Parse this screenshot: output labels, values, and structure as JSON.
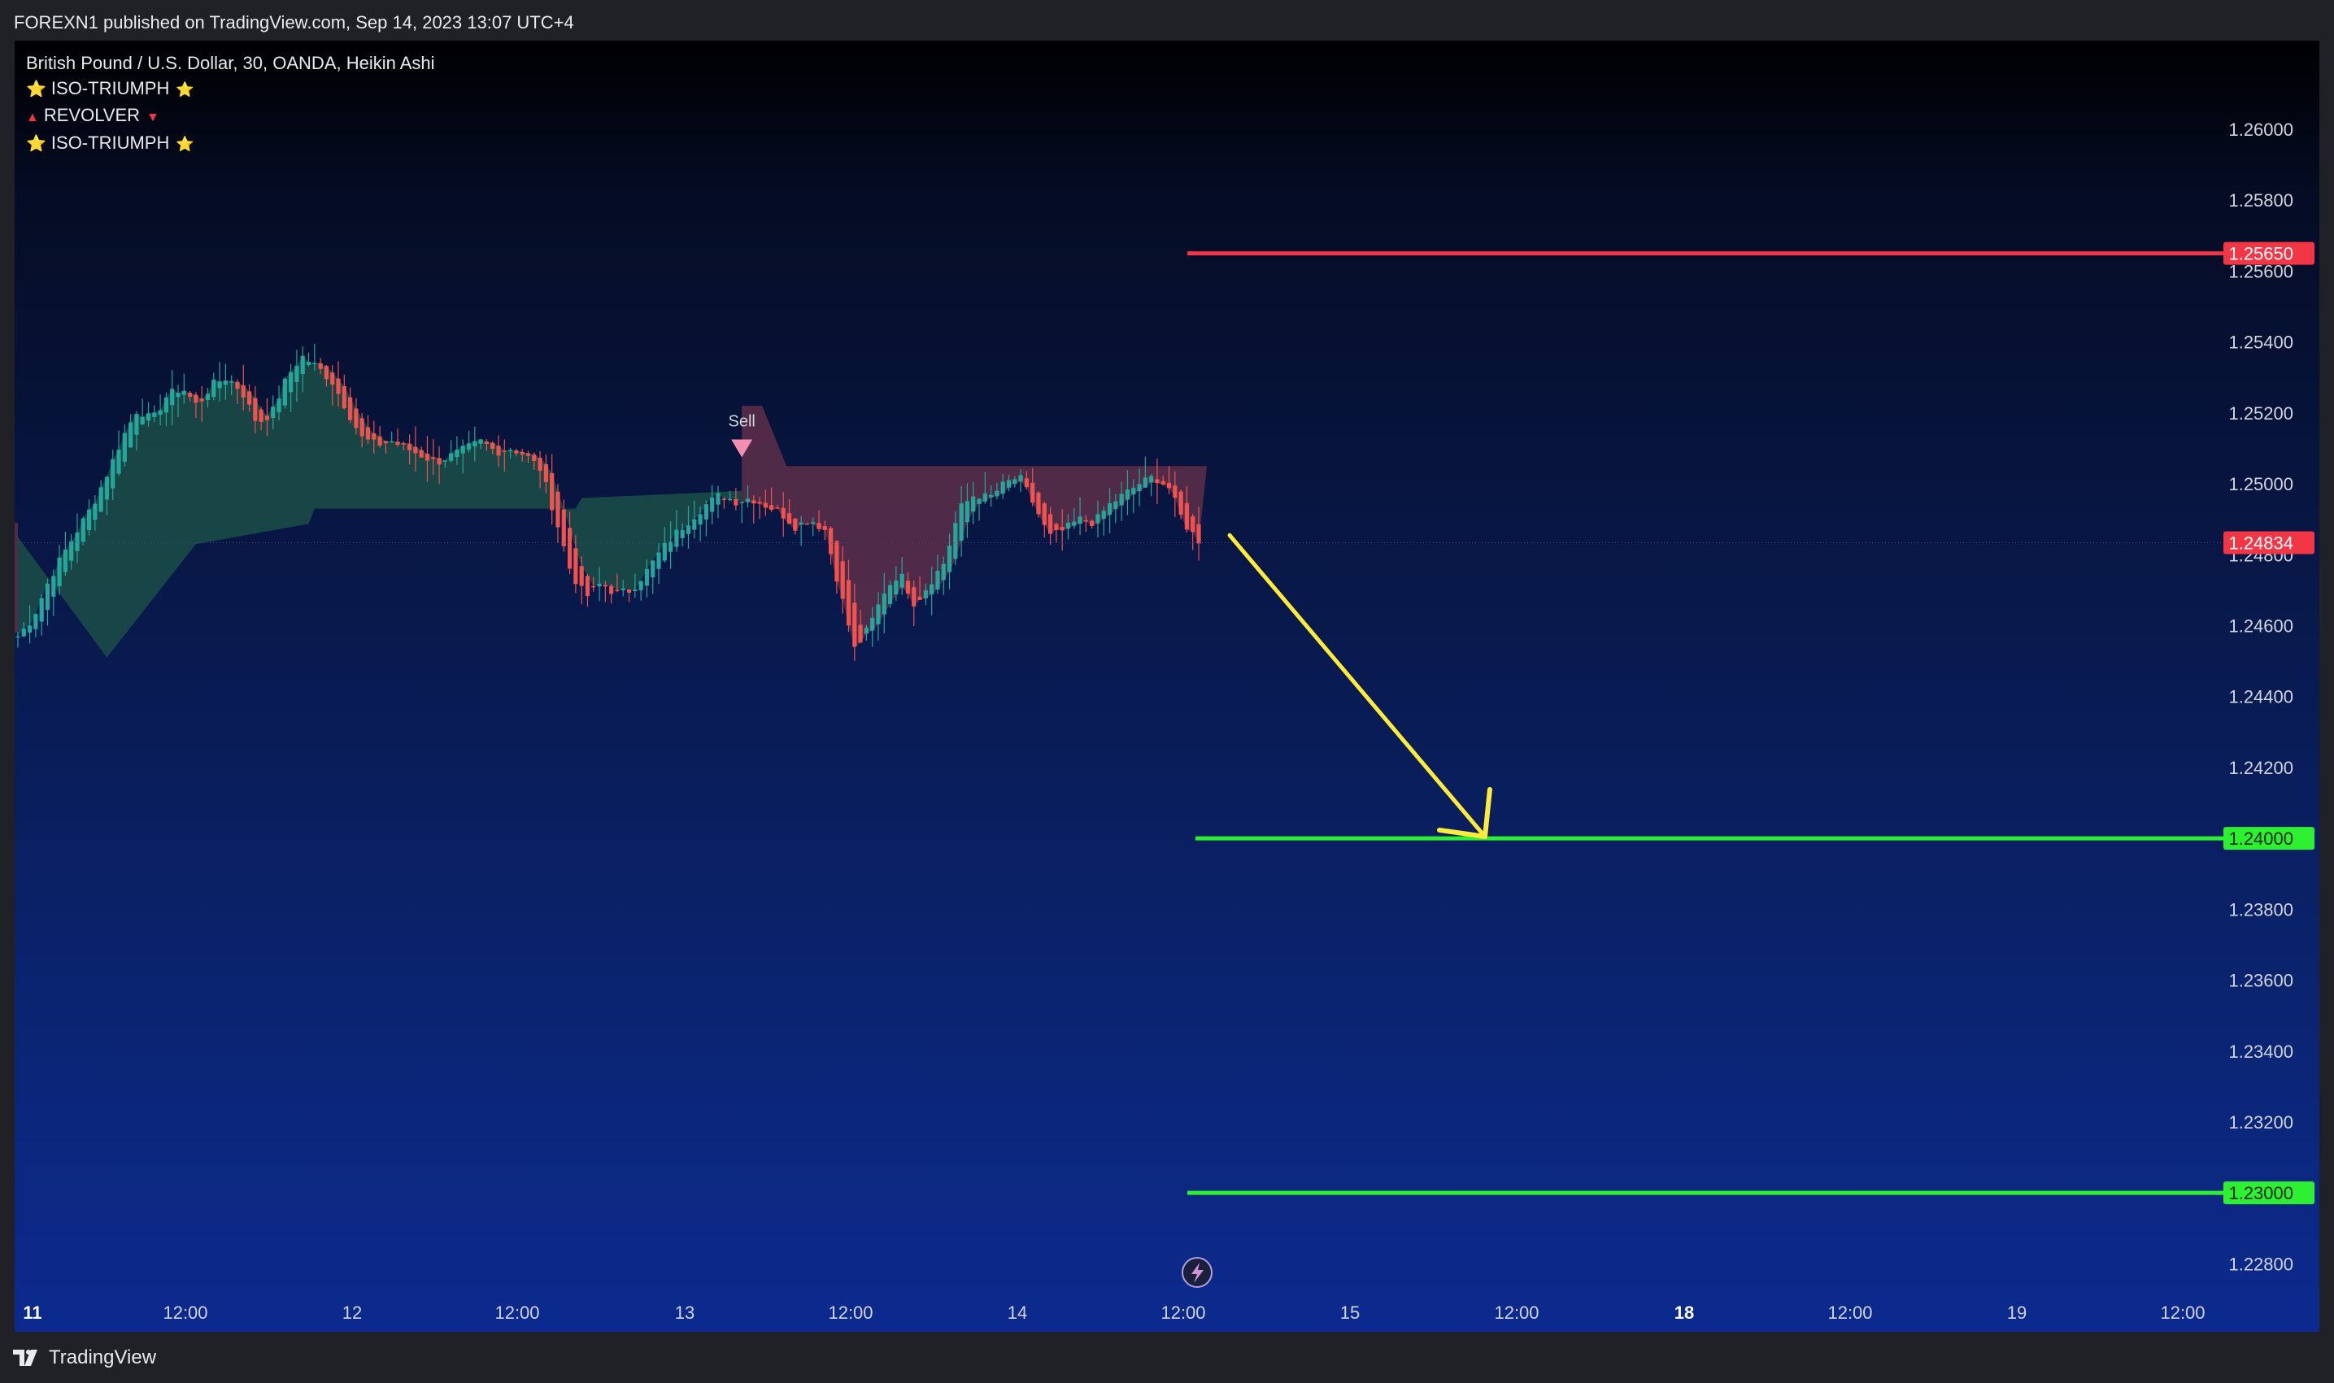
{
  "header": {
    "published_text": "FOREXN1 published on TradingView.com, Sep 14, 2023 13:07 UTC+4"
  },
  "legend": {
    "symbol_line": "British Pound / U.S. Dollar, 30, OANDA, Heikin Ashi",
    "indicators": [
      {
        "label": "ISO-TRIUMPH",
        "icon_left": "star-icon",
        "icon_right": "star-icon"
      },
      {
        "label": "REVOLVER",
        "icon_left": "triangle-up-icon",
        "icon_right": "triangle-down-icon"
      },
      {
        "label": "ISO-TRIUMPH",
        "icon_left": "star-icon",
        "icon_right": "star-icon"
      }
    ]
  },
  "signal": {
    "label": "Sell",
    "price": 1.2507
  },
  "footer": {
    "brand": "TradingView"
  },
  "colors": {
    "up_candle": "#26a69a",
    "down_candle": "#ef5350",
    "resistance_line": "#f23645",
    "target_line": "#2cf030",
    "arrow": "#ffeb3b",
    "bull_band": "#1b4d46",
    "bear_band": "#5d2f4a"
  },
  "chart_data": {
    "type": "candlestick",
    "ylim": [
      1.227,
      1.2625
    ],
    "y_ticks": [
      "1.26000",
      "1.25800",
      "1.25600",
      "1.25400",
      "1.25200",
      "1.25000",
      "1.24800",
      "1.24600",
      "1.24400",
      "1.24200",
      "1.24000",
      "1.23800",
      "1.23600",
      "1.23400",
      "1.23200",
      "1.23000",
      "1.22800"
    ],
    "x_ticks": [
      {
        "label": "11",
        "bold": true
      },
      {
        "label": "12:00",
        "bold": false
      },
      {
        "label": "12",
        "bold": false
      },
      {
        "label": "12:00",
        "bold": false
      },
      {
        "label": "13",
        "bold": false
      },
      {
        "label": "12:00",
        "bold": false
      },
      {
        "label": "14",
        "bold": false
      },
      {
        "label": "12:00",
        "bold": false
      },
      {
        "label": "15",
        "bold": false
      },
      {
        "label": "12:00",
        "bold": false
      },
      {
        "label": "18",
        "bold": true
      },
      {
        "label": "12:00",
        "bold": false
      },
      {
        "label": "19",
        "bold": false
      },
      {
        "label": "12:00",
        "bold": false
      }
    ],
    "price_lines": [
      {
        "name": "resistance",
        "value": 1.2565,
        "label": "1.25650",
        "color": "#f23645"
      },
      {
        "name": "current",
        "value": 1.24834,
        "label": "1.24834",
        "color": "#f23645"
      },
      {
        "name": "target-1",
        "value": 1.24,
        "label": "1.24000",
        "color": "#2cf030"
      },
      {
        "name": "target-2",
        "value": 1.23,
        "label": "1.23000",
        "color": "#2cf030"
      }
    ],
    "price_path": [
      1.2457,
      1.2462,
      1.2472,
      1.248,
      1.2487,
      1.2494,
      1.2503,
      1.2513,
      1.2521,
      1.2518,
      1.2525,
      1.2527,
      1.2522,
      1.2528,
      1.253,
      1.2526,
      1.2517,
      1.252,
      1.253,
      1.2536,
      1.2533,
      1.2529,
      1.2521,
      1.2513,
      1.2511,
      1.2512,
      1.251,
      1.2508,
      1.2506,
      1.2508,
      1.251,
      1.2512,
      1.2509,
      1.251,
      1.2508,
      1.2504,
      1.249,
      1.2475,
      1.2468,
      1.2472,
      1.2469,
      1.247,
      1.2475,
      1.2481,
      1.2486,
      1.249,
      1.2494,
      1.2497,
      1.2495,
      1.2496,
      1.2494,
      1.2492,
      1.2488,
      1.249,
      1.2487,
      1.247,
      1.2453,
      1.246,
      1.247,
      1.2475,
      1.2466,
      1.2472,
      1.2478,
      1.2493,
      1.2497,
      1.2496,
      1.25,
      1.2502,
      1.2494,
      1.2485,
      1.2487,
      1.249,
      1.2489,
      1.2494,
      1.2497,
      1.25,
      1.2502,
      1.2499,
      1.2489,
      1.2484
    ]
  }
}
